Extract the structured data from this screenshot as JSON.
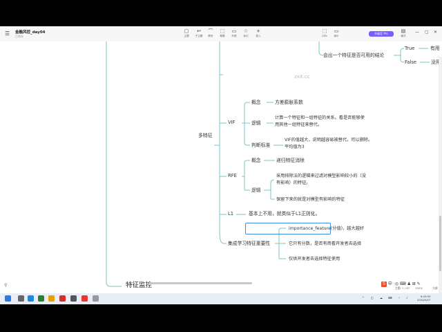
{
  "window": {
    "title": "金融风控_day04",
    "subtitle": "已保存"
  },
  "toolbar": {
    "items": [
      {
        "glyph": "▢",
        "label": "主题"
      },
      {
        "glyph": "↩",
        "label": "子主题"
      },
      {
        "glyph": "⌒",
        "label": "联系"
      },
      {
        "glyph": "⬚",
        "label": "概要"
      },
      {
        "glyph": "▭",
        "label": "外框"
      },
      {
        "glyph": "☆",
        "label": "标记"
      },
      {
        "glyph": "+",
        "label": "插入"
      }
    ],
    "right_items": [
      {
        "glyph": "⬚",
        "label": "ZEN"
      },
      {
        "glyph": "▭",
        "label": "演示"
      },
      {
        "glyph": "▤",
        "label": "格式"
      }
    ],
    "pro_label": "升级至 Pro"
  },
  "mindmap": {
    "watermark": "zxit.cc",
    "top_branch": {
      "label": "会出一个特征是否可用的结论",
      "true": "True",
      "true_leaf": "有用",
      "false": "False",
      "false_leaf": "没用"
    },
    "multi_feature": "多特征",
    "vif": {
      "label": "VIF",
      "concept": "概念",
      "concept_text": "方差膨胀系数",
      "logic": "逻辑",
      "logic_text_1": "计算一个特征和一组特征的关系。看是否能够使",
      "logic_text_2": "用其他一组特征来替代。",
      "judge": "判断标准",
      "judge_text_1": "VIF的值越大，说明越容易被替代，可以删除。",
      "judge_text_2": "平均值为3"
    },
    "rfe": {
      "label": "RFE",
      "concept": "概念",
      "concept_text": "递归特征消除",
      "logic": "逻辑",
      "logic_text_1": "采用排除法的逻辑来过滤对模型影响较小的（没",
      "logic_text_2": "有影响）的特征。",
      "logic_text_3": "保留下来的就是对模型有影响的特征"
    },
    "l1": {
      "label": "L1",
      "text": "基本上不用，就类似于L1正则化。"
    },
    "ensemble": {
      "label": "集成学习特征重要性",
      "item1": "importance_feature(分值)，越大越好",
      "item2": "它只有分数，是否有用看开发者去选择",
      "item3": "仅供开发者去选择特征使用"
    },
    "monitor": "特征监控"
  },
  "status": {
    "topic_count": "主题: 1 / 87",
    "zoom": "150%",
    "view": "大纲"
  },
  "taskbar": {
    "ime_label": "中",
    "clock_time": "9:43:03",
    "clock_date": "2024/5/27"
  }
}
